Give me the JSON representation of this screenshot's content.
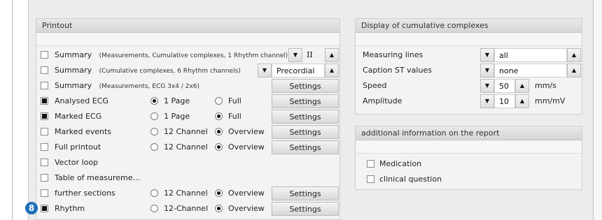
{
  "printout": {
    "title": "Printout",
    "rows": [
      {
        "checked": false,
        "label": "Summary",
        "sub": "(Measurements, Cumulative complexes, 1 Rhythm channel)",
        "select_value": "II"
      },
      {
        "checked": false,
        "label": "Summary",
        "sub": "(Cumulative complexes, 6 Rhythm channels)",
        "select_value": "Precordial"
      },
      {
        "checked": false,
        "label": "Summary",
        "sub": "(Measurements, ECG 3x4 / 2x6)",
        "button": "Settings"
      },
      {
        "checked": true,
        "label": "Analysed ECG",
        "opt1": "1 Page",
        "opt2": "Full",
        "selected": 1,
        "button": "Settings"
      },
      {
        "checked": true,
        "label": "Marked ECG",
        "opt1": "1 Page",
        "opt2": "Full",
        "selected": 2,
        "button": "Settings"
      },
      {
        "checked": false,
        "label": "Marked events",
        "opt1": "12 Channel",
        "opt2": "Overview",
        "selected": 2,
        "button": "Settings"
      },
      {
        "checked": false,
        "label": "Full printout",
        "opt1": "12 Channel",
        "opt2": "Overview",
        "selected": 2,
        "button": "Settings"
      },
      {
        "checked": false,
        "label": "Vector loop"
      },
      {
        "checked": false,
        "label": "Table of measureme..."
      },
      {
        "checked": false,
        "label": "further sections",
        "opt1": "12 Channel",
        "opt2": "Overview",
        "selected": 2,
        "button": "Settings"
      },
      {
        "checked": true,
        "label": "Rhythm",
        "opt1": "12-Channel",
        "opt2": "Overview",
        "selected": 2,
        "button": "Settings"
      }
    ]
  },
  "cumulative": {
    "title": "Display of cumulative complexes",
    "measuring_lines": {
      "label": "Measuring lines",
      "value": "all"
    },
    "caption_st": {
      "label": "Caption ST values",
      "value": "none"
    },
    "speed": {
      "label": "Speed",
      "value": "50",
      "unit": "mm/s"
    },
    "amplitude": {
      "label": "Amplitude",
      "value": "10",
      "unit": "mm/mV"
    }
  },
  "additional": {
    "title": "additional information on the report",
    "medication": "Medication",
    "clinical_question": "clinical question"
  },
  "callout": "8",
  "colors": {
    "badge": "#1d6fb8",
    "panel_header": "#d6d6d6"
  }
}
